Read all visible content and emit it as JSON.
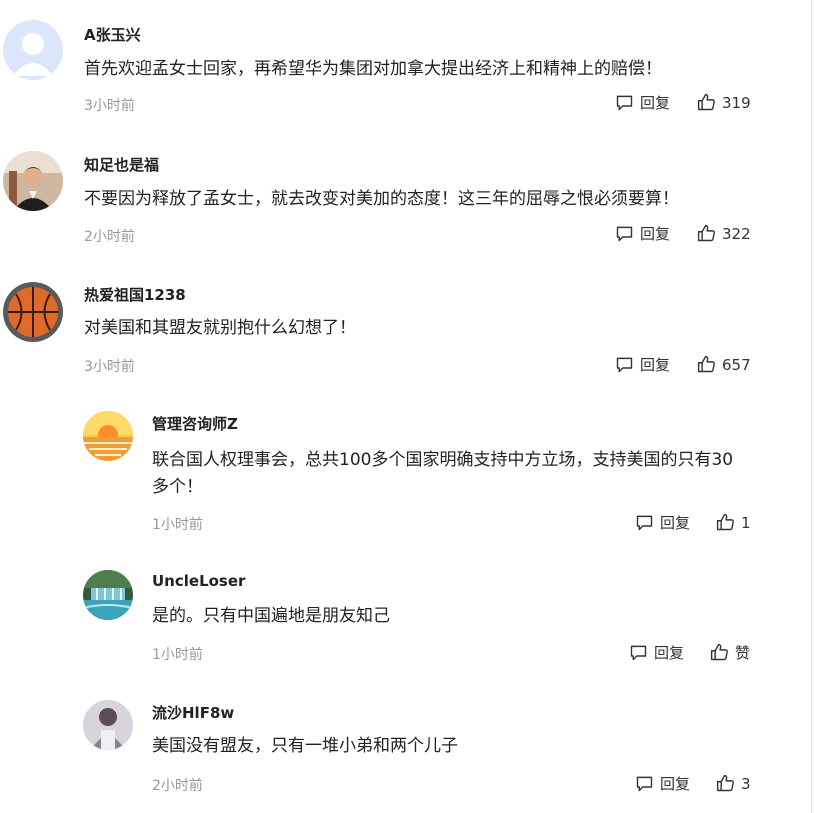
{
  "comments": [
    {
      "user": "A张玉兴",
      "text": "首先欢迎孟女士回家，再希望华为集团对加拿大提出经济上和精神上的赔偿！",
      "time": "3小时前",
      "reply_label": "回复",
      "likes": "319",
      "avatar": "default-avatar-icon"
    },
    {
      "user": "知足也是福",
      "text": "不要因为释放了孟女士，就去改变对美加的态度！这三年的屈辱之恨必须要算！",
      "time": "2小时前",
      "reply_label": "回复",
      "likes": "322",
      "avatar": "man-portrait-avatar"
    },
    {
      "user": "热爱祖国1238",
      "text": "对美国和其盟友就别抱什么幻想了！",
      "time": "3小时前",
      "reply_label": "回复",
      "likes": "657",
      "avatar": "basketball-avatar"
    }
  ],
  "replies": [
    {
      "user": "管理咨询师Z",
      "text_lines": [
        "联合国人权理事会，总共100多个国家明确支持中方立场，支持美国的只有30",
        "多个！"
      ],
      "time": "1小时前",
      "reply_label": "回复",
      "likes": "1",
      "avatar": "sunset-avatar"
    },
    {
      "user": "UncleLoser",
      "text_lines": [
        "是的。只有中国遍地是朋友知己"
      ],
      "time": "1小时前",
      "reply_label": "回复",
      "likes": "赞",
      "avatar": "waterfall-avatar"
    },
    {
      "user": "流沙HlF8w",
      "text_lines": [
        "美国没有盟友，只有一堆小弟和两个儿子"
      ],
      "time": "2小时前",
      "reply_label": "回复",
      "likes": "3",
      "avatar": "person-avatar"
    }
  ],
  "colors": {
    "time": "#999999",
    "text": "#222222",
    "frame": "#e6e6e6"
  }
}
